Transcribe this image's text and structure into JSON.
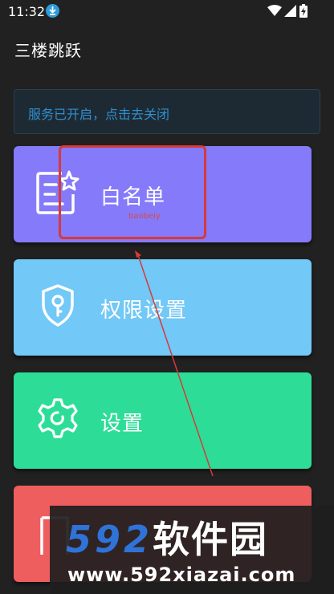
{
  "status_bar": {
    "time": "11:32"
  },
  "app": {
    "title": "三楼跳跃"
  },
  "service_banner": {
    "text": "服务已开启，点击去关闭"
  },
  "cards": [
    {
      "label": "白名单",
      "color": "#857af9",
      "icon": "whitelist-icon"
    },
    {
      "label": "权限设置",
      "color": "#72c8f6",
      "icon": "shield-key-icon"
    },
    {
      "label": "设置",
      "color": "#2ddd97",
      "icon": "gear-icon"
    },
    {
      "label": "",
      "color": "#ee5e5f",
      "icon": "document-icon"
    }
  ],
  "annotation": {
    "caption": "baobeiy",
    "color": "#d63a3a"
  },
  "watermark": {
    "logo_number": "592",
    "logo_text": "软件园",
    "url": "www.592xiazai.com"
  }
}
